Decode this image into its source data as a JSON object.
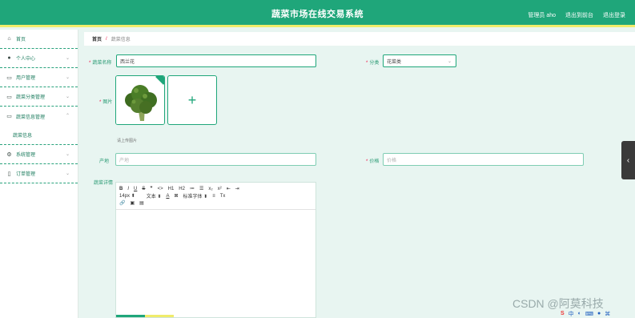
{
  "header": {
    "title": "蔬菜市场在线交易系统",
    "user": "管理员 aho",
    "links": [
      "退出到前台",
      "退出登录"
    ]
  },
  "sidebar": {
    "items": [
      {
        "label": "首页",
        "icon": "home-icon",
        "expandable": false
      },
      {
        "label": "个人中心",
        "icon": "user-icon",
        "expandable": true
      },
      {
        "label": "用户管理",
        "icon": "users-icon",
        "expandable": true
      },
      {
        "label": "蔬菜分类管理",
        "icon": "list-icon",
        "expandable": true
      },
      {
        "label": "蔬菜信息管理",
        "icon": "folder-icon",
        "expandable": true,
        "expanded": true,
        "children": [
          "蔬菜信息"
        ]
      },
      {
        "label": "系统管理",
        "icon": "gear-icon",
        "expandable": true
      },
      {
        "label": "订单管理",
        "icon": "clipboard-icon",
        "expandable": true
      }
    ]
  },
  "breadcrumb": {
    "home": "首页",
    "separator": "/",
    "current": "蔬菜信息"
  },
  "form": {
    "name_label": "蔬菜名称",
    "name_value": "西兰花",
    "category_label": "分类",
    "category_value": "花菜类",
    "image_label": "图片",
    "image_hint": "请上传图片",
    "origin_label": "产地",
    "origin_placeholder": "产地",
    "price_label": "价格",
    "price_placeholder": "价格",
    "detail_label": "蔬菜详情"
  },
  "editor_toolbar": {
    "row1": [
      "B",
      "I",
      "U",
      "S",
      "❞",
      "<>",
      "H1",
      "H2",
      "≔",
      "☰",
      "x₂",
      "x²",
      "⇤",
      "⇥"
    ],
    "row2": [
      "14px",
      "文本",
      "A",
      "⊠",
      "标准字体",
      "≡",
      "Tx"
    ],
    "row3": [
      "🔗",
      "▣",
      "▤"
    ]
  },
  "watermark": "CSDN @阿莫科技",
  "colors": {
    "primary": "#1fa67a",
    "accent": "#f0ec6a",
    "background": "#e8f5f1"
  }
}
